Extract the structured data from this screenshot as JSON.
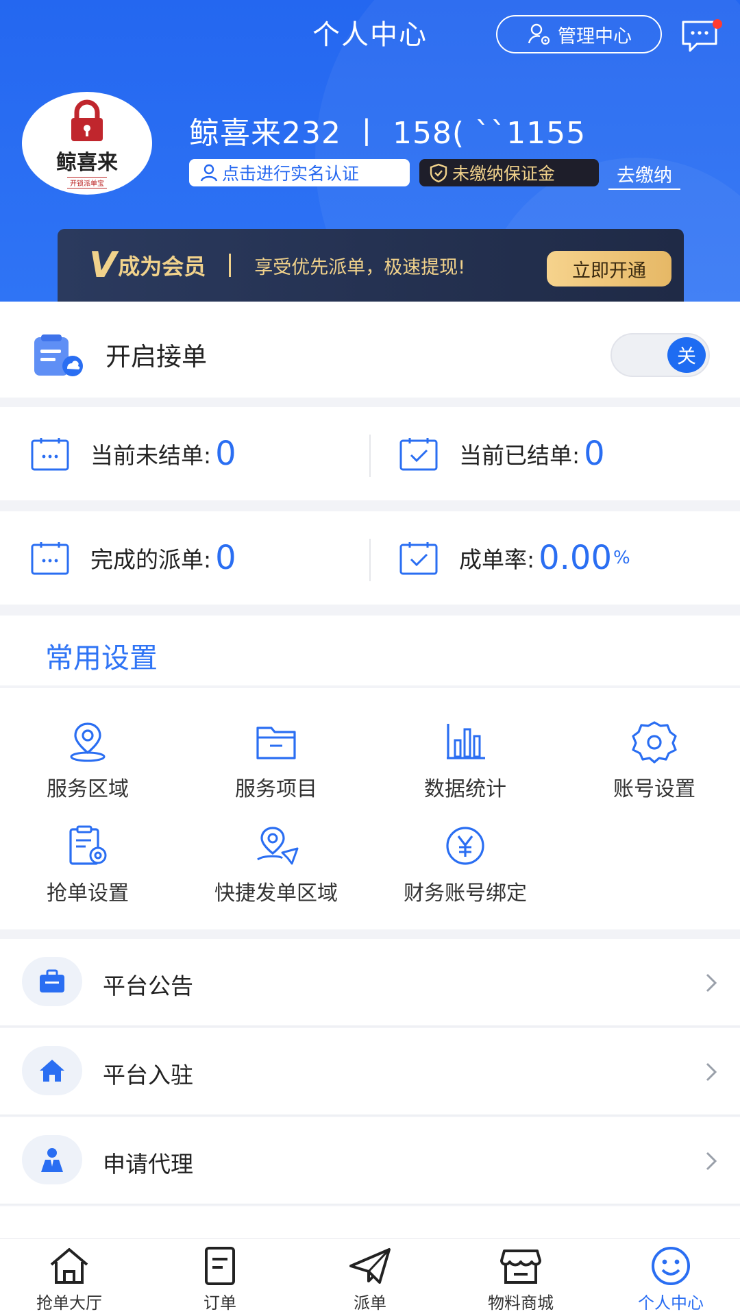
{
  "header": {
    "title": "个人中心",
    "admin_label": "管理中心",
    "avatar": {
      "brand": "鲸喜来",
      "slogan": "开锁派单宝"
    },
    "user_line": "鲸喜来232 丨 158( ``1155",
    "real_name_label": "点击进行实名认证",
    "deposit_label": "未缴纳保证金",
    "go_pay_label": "去缴纳"
  },
  "vip": {
    "v_mark": "V",
    "title": "成为会员",
    "desc": "享受优先派单，极速提现!",
    "button": "立即开通"
  },
  "order_switch": {
    "label": "开启接单",
    "toggle_text": "关"
  },
  "stats": [
    {
      "label": "当前未结单:",
      "value": "0",
      "unit": ""
    },
    {
      "label": "当前已结单:",
      "value": "0",
      "unit": ""
    },
    {
      "label": "完成的派单:",
      "value": "0",
      "unit": ""
    },
    {
      "label": "成单率:",
      "value": "0.00",
      "unit": "%"
    }
  ],
  "common": {
    "title": "常用设置",
    "items": [
      {
        "label": "服务区域",
        "icon": "location-pin-icon"
      },
      {
        "label": "服务项目",
        "icon": "folder-icon"
      },
      {
        "label": "数据统计",
        "icon": "bar-chart-icon"
      },
      {
        "label": "账号设置",
        "icon": "gear-icon"
      },
      {
        "label": "抢单设置",
        "icon": "clipboard-gear-icon"
      },
      {
        "label": "快捷发单区域",
        "icon": "location-send-icon"
      },
      {
        "label": "财务账号绑定",
        "icon": "yuan-icon"
      }
    ]
  },
  "list": [
    {
      "label": "平台公告",
      "icon": "briefcase-icon"
    },
    {
      "label": "平台入驻",
      "icon": "home-icon"
    },
    {
      "label": "申请代理",
      "icon": "agent-icon"
    }
  ],
  "tabs": [
    {
      "label": "抢单大厅",
      "active": false
    },
    {
      "label": "订单",
      "active": false
    },
    {
      "label": "派单",
      "active": false
    },
    {
      "label": "物料商城",
      "active": false
    },
    {
      "label": "个人中心",
      "active": true
    }
  ],
  "colors": {
    "primary": "#2467f0",
    "accent_blue": "#2a6ef2",
    "gold": "#f1d28b",
    "notification": "#ff3b30"
  }
}
